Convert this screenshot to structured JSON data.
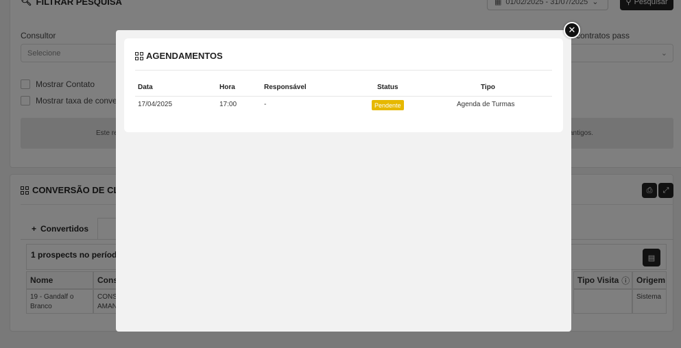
{
  "filter": {
    "title": "FILTRAR PESQUISA",
    "date_range": "01/02/2025 - 31/07/2025",
    "search_label": "Pesquisar",
    "consultor_label": "Consultor",
    "consultor_placeholder": "Selecione",
    "right_label": "contratos pass",
    "show_contact_label": "Mostrar Contato",
    "show_rate_label": "Mostrar taxa de conve",
    "info_left": "Este re",
    "info_right": "antigos."
  },
  "conversion": {
    "title": "CONVERSÃO DE CLI",
    "tab_converted": "Convertidos",
    "count_text": "1 prospects no período",
    "columns": [
      "Nome",
      "Cons",
      "Tipo Visita",
      "Origem"
    ],
    "row": {
      "name_line1": "19 - Gandalf o",
      "name_line2": "Branco",
      "consultor_line1": "CONS",
      "consultor_line2": "AMAN",
      "origem": "Sistema"
    }
  },
  "modal": {
    "title": "AGENDAMENTOS",
    "columns": {
      "data": "Data",
      "hora": "Hora",
      "responsavel": "Responsável",
      "status": "Status",
      "tipo": "Tipo"
    },
    "row": {
      "data": "17/04/2025",
      "hora": "17:00",
      "responsavel": "-",
      "status": "Pendente",
      "tipo": "Agenda de Turmas"
    },
    "close_symbol": "✕",
    "status_color": "#e6b800"
  }
}
